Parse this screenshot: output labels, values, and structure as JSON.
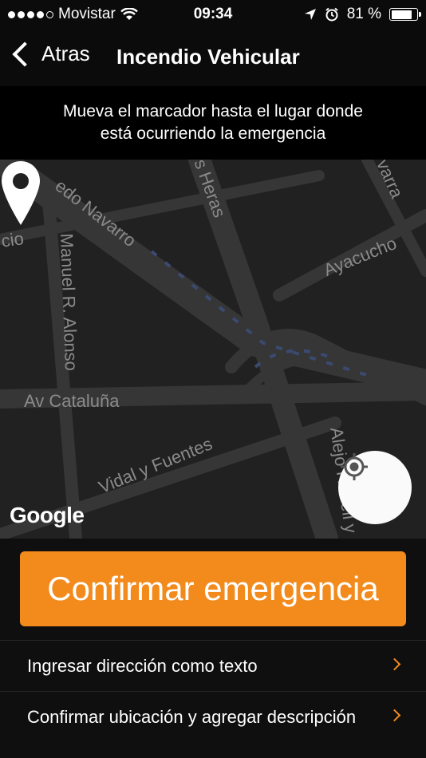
{
  "status_bar": {
    "carrier": "Movistar",
    "time": "09:34",
    "battery": "81 %",
    "battery_level": 0.81,
    "icons": [
      "signal-dots",
      "wifi-icon",
      "location-arrow-icon",
      "alarm-icon",
      "battery-icon"
    ]
  },
  "nav": {
    "back_label": "Atras",
    "title": "Incendio Vehicular"
  },
  "instruction": {
    "line1": "Mueva el marcador hasta el lugar donde",
    "line2": "está ocurriendo la emergencia"
  },
  "map": {
    "streets": {
      "s1": "edo Navarro",
      "s2": "s Heras",
      "s3": "varra",
      "s4": "cio",
      "s5": "Manuel R. Alonso",
      "s6": "Ayacucho",
      "s7": "Av Cataluña",
      "s8": "Vidal y Fuentes",
      "s9": "Alejo Rosell y"
    },
    "attribution": "Google",
    "marker_icon": "map-pin-icon",
    "locate_icon": "crosshair-icon"
  },
  "actions": {
    "confirm_label": "Confirmar emergencia",
    "rows": [
      {
        "label": "Ingresar dirección como texto"
      },
      {
        "label": "Confirmar ubicación y agregar descripción"
      }
    ]
  },
  "colors": {
    "accent": "#f28a1c",
    "map_bg": "#212121",
    "road": "#3a3a3a",
    "route": "#3a4a70"
  }
}
